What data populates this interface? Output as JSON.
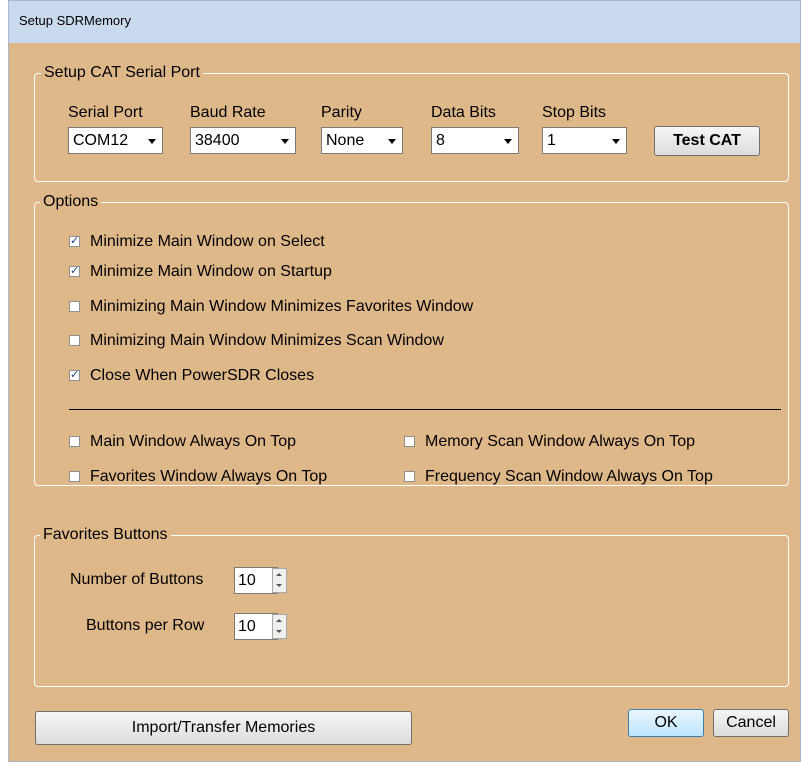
{
  "window": {
    "title": "Setup SDRMemory"
  },
  "serial_port_group": {
    "title": "Setup CAT Serial Port",
    "labels": {
      "serial_port": "Serial Port",
      "baud_rate": "Baud Rate",
      "parity": "Parity",
      "data_bits": "Data Bits",
      "stop_bits": "Stop Bits"
    },
    "values": {
      "serial_port": "COM12",
      "baud_rate": "38400",
      "parity": "None",
      "data_bits": "8",
      "stop_bits": "1"
    },
    "test_button": "Test CAT"
  },
  "options_group": {
    "title": "Options",
    "checkboxes": [
      {
        "label": "Minimize Main Window on Select",
        "checked": true
      },
      {
        "label": "Minimize Main Window on Startup",
        "checked": true
      },
      {
        "label": "Minimizing Main Window Minimizes Favorites Window",
        "checked": false
      },
      {
        "label": "Minimizing Main Window Minimizes Scan Window",
        "checked": false
      },
      {
        "label": "Close When PowerSDR Closes",
        "checked": true
      }
    ],
    "ontop": [
      {
        "label": "Main Window Always On Top",
        "checked": false
      },
      {
        "label": "Memory Scan Window Always On Top",
        "checked": false
      },
      {
        "label": "Favorites Window Always On Top",
        "checked": false
      },
      {
        "label": "Frequency Scan Window Always On Top",
        "checked": false
      }
    ]
  },
  "favorites_group": {
    "title": "Favorites Buttons",
    "num_buttons_label": "Number of Buttons",
    "num_buttons_value": "10",
    "per_row_label": "Buttons per Row",
    "per_row_value": "10"
  },
  "footer": {
    "import_button": "Import/Transfer Memories",
    "ok_button": "OK",
    "cancel_button": "Cancel"
  },
  "colors": {
    "background": "#dfb88a",
    "titlebar": "#c9daef"
  },
  "check_glyph": "✓"
}
